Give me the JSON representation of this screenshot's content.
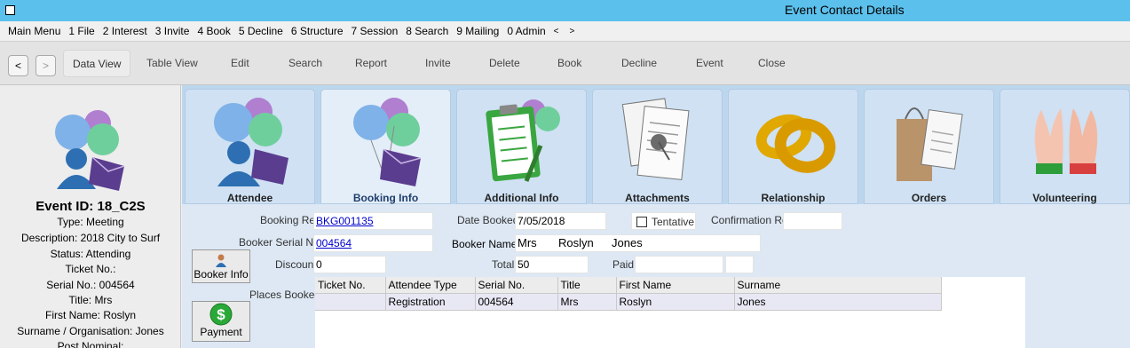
{
  "window": {
    "title": "Event Contact Details"
  },
  "menu": [
    "Main Menu",
    "1 File",
    "2 Interest",
    "3 Invite",
    "4 Book",
    "5 Decline",
    "6 Structure",
    "7 Session",
    "8 Search",
    "9 Mailing",
    "0 Admin"
  ],
  "menu_arrows": {
    "left": "<",
    "right": ">"
  },
  "toolbar": {
    "back": "<",
    "forward": ">",
    "data_view": "Data View",
    "table_view": "Table View",
    "edit": "Edit",
    "search": "Search",
    "report": "Report",
    "invite": "Invite",
    "delete": "Delete",
    "book": "Book",
    "decline": "Decline",
    "event": "Event",
    "close": "Close"
  },
  "sidebar": {
    "event_id": "Event ID: 18_C2S",
    "lines": [
      "Type: Meeting",
      "Description: 2018 City to Surf",
      "Status: Attending",
      "Ticket No.:",
      "Serial No.: 004564",
      "Title: Mrs",
      "First Name: Roslyn",
      "Surname / Organisation: Jones",
      "Post Nominal:"
    ]
  },
  "tabs": [
    {
      "label": "Attendee",
      "icon": "attendee-balloons-icon"
    },
    {
      "label": "Booking Info",
      "icon": "booking-balloons-icon",
      "active": true
    },
    {
      "label": "Additional Info",
      "icon": "clipboard-icon"
    },
    {
      "label": "Attachments",
      "icon": "document-pin-icon"
    },
    {
      "label": "Relationship",
      "icon": "rings-icon"
    },
    {
      "label": "Orders",
      "icon": "shopping-bag-icon"
    },
    {
      "label": "Volunteering",
      "icon": "raised-hands-icon"
    }
  ],
  "form": {
    "booking_ref": {
      "label": "Booking Ref",
      "value": "BKG001135"
    },
    "date_booked": {
      "label": "Date Booked",
      "value": "7/05/2018"
    },
    "tentative": {
      "label": "Tentative",
      "checked": false
    },
    "confirmation_ref": {
      "label": "Confirmation Ref",
      "value": ""
    },
    "booker_serial": {
      "label": "Booker Serial No",
      "value": "004564"
    },
    "booker_name": {
      "label": "Booker Name",
      "title": "Mrs",
      "first": "Roslyn",
      "last": "Jones"
    },
    "discount": {
      "label": "Discount",
      "value": "0"
    },
    "total": {
      "label": "Total",
      "value": "50"
    },
    "paid": {
      "label": "Paid",
      "value": ""
    },
    "places_booked_label": "Places Booked",
    "booker_info_button": "Booker Info",
    "payment_button": "Payment"
  },
  "places_booked": {
    "columns": [
      "Ticket No.",
      "Attendee Type",
      "Serial No.",
      "Title",
      "First Name",
      "Surname"
    ],
    "rows": [
      [
        "",
        "Registration",
        "004564",
        "Mrs",
        "Roslyn",
        "Jones"
      ]
    ]
  },
  "colors": {
    "titlebar": "#5bc0ec",
    "tabstrip": "#bcd6ee",
    "form_bg": "#dde8f4",
    "link": "#0000cc"
  }
}
